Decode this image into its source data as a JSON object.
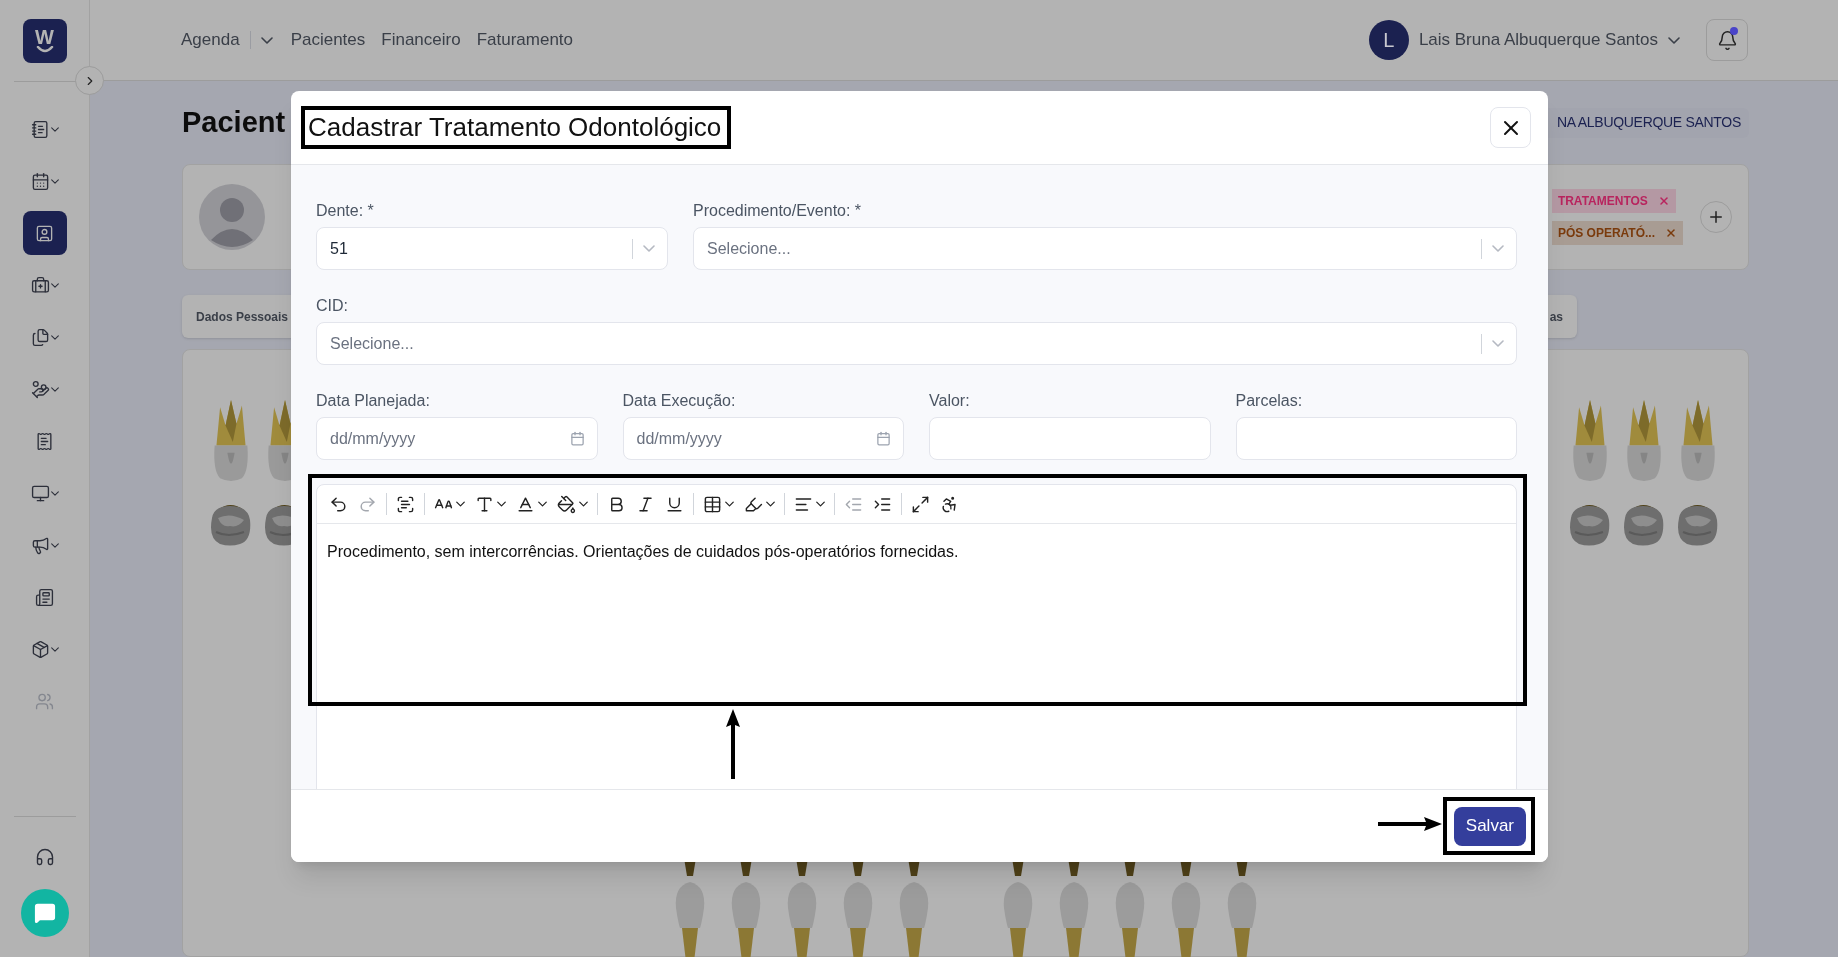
{
  "sidebar": {
    "logo": "W",
    "items": [
      {
        "selected": false,
        "submenu": true,
        "disabled": false
      },
      {
        "selected": false,
        "submenu": true,
        "disabled": false
      },
      {
        "selected": true,
        "submenu": false,
        "disabled": false
      },
      {
        "selected": false,
        "submenu": true,
        "disabled": false
      },
      {
        "selected": false,
        "submenu": true,
        "disabled": false
      },
      {
        "selected": false,
        "submenu": true,
        "disabled": false
      },
      {
        "selected": false,
        "submenu": false,
        "disabled": false
      },
      {
        "selected": false,
        "submenu": true,
        "disabled": false
      },
      {
        "selected": false,
        "submenu": true,
        "disabled": false
      },
      {
        "selected": false,
        "submenu": false,
        "disabled": false
      },
      {
        "selected": false,
        "submenu": true,
        "disabled": false
      },
      {
        "selected": false,
        "submenu": false,
        "disabled": true
      }
    ]
  },
  "header": {
    "nav": [
      {
        "label": "Agenda",
        "dropdown": true
      },
      {
        "label": "Pacientes",
        "dropdown": false
      },
      {
        "label": "Financeiro",
        "dropdown": false
      },
      {
        "label": "Faturamento",
        "dropdown": false
      }
    ],
    "user": {
      "initial": "L",
      "name": "Lais Bruna Albuquerque Santos"
    },
    "notifications": {
      "unread": true
    }
  },
  "page": {
    "title": "Pacient",
    "patient_button": "NA ALBUQUERQUE SANTOS",
    "tags": [
      {
        "label": "TRATAMENTOS",
        "color": "#b8245e"
      },
      {
        "label": "PÓS OPERATÓ...",
        "color": "#7a3a0c"
      }
    ],
    "tabs": [
      {
        "label": "Dados Pessoais"
      },
      {
        "label": "as"
      }
    ]
  },
  "modal": {
    "title": "Cadastrar Tratamento Odontológico",
    "rows": [
      [
        {
          "label": "Dente: *",
          "kind": "select",
          "value": "51"
        },
        {
          "label": "Procedimento/Evento: *",
          "kind": "select",
          "placeholder": "Selecione..."
        }
      ],
      [
        {
          "label": "CID:",
          "kind": "select",
          "placeholder": "Selecione..."
        }
      ],
      [
        {
          "label": "Data Planejada:",
          "kind": "date",
          "placeholder": "dd/mm/yyyy"
        },
        {
          "label": "Data Execução:",
          "kind": "date",
          "placeholder": "dd/mm/yyyy"
        },
        {
          "label": "Valor:",
          "kind": "text"
        },
        {
          "label": "Parcelas:",
          "kind": "text"
        }
      ]
    ],
    "toolbar": [
      {
        "kind": "button",
        "disabled": false,
        "dropdown": false
      },
      {
        "kind": "button",
        "disabled": true,
        "dropdown": false
      },
      {
        "kind": "separator"
      },
      {
        "kind": "button",
        "disabled": false,
        "dropdown": false
      },
      {
        "kind": "separator"
      },
      {
        "kind": "button",
        "disabled": false,
        "dropdown": true
      },
      {
        "kind": "button",
        "disabled": false,
        "dropdown": true
      },
      {
        "kind": "button",
        "disabled": false,
        "dropdown": true
      },
      {
        "kind": "button",
        "disabled": false,
        "dropdown": true
      },
      {
        "kind": "separator"
      },
      {
        "kind": "button",
        "disabled": false,
        "dropdown": false
      },
      {
        "kind": "button",
        "disabled": false,
        "dropdown": false
      },
      {
        "kind": "button",
        "disabled": false,
        "dropdown": false
      },
      {
        "kind": "separator"
      },
      {
        "kind": "button",
        "disabled": false,
        "dropdown": true
      },
      {
        "kind": "button",
        "disabled": false,
        "dropdown": true
      },
      {
        "kind": "separator"
      },
      {
        "kind": "button",
        "disabled": false,
        "dropdown": true
      },
      {
        "kind": "separator"
      },
      {
        "kind": "button",
        "disabled": true,
        "dropdown": false
      },
      {
        "kind": "button",
        "disabled": false,
        "dropdown": false
      },
      {
        "kind": "separator"
      },
      {
        "kind": "button",
        "disabled": false,
        "dropdown": false
      },
      {
        "kind": "button",
        "disabled": false,
        "dropdown": false
      }
    ],
    "editor_text": "Procedimento, sem intercorrências. Orientações de cuidados pós-operatórios fornecidas.",
    "save_button": "Salvar"
  }
}
